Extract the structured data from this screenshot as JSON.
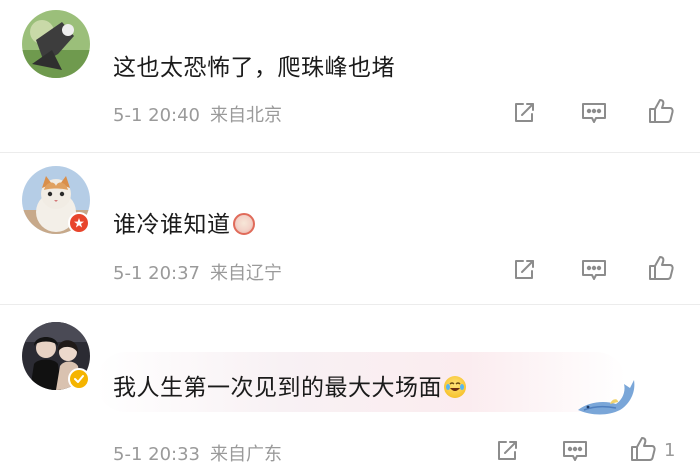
{
  "comments": [
    {
      "text": "这也太恐怖了，爬珠峰也堵",
      "time": "5-1 20:40",
      "location": "来自北京",
      "like_count": ""
    },
    {
      "text": "谁冷谁知道",
      "time": "5-1 20:37",
      "location": "来自辽宁",
      "like_count": "",
      "emoji": "laughing-crying-emoji"
    },
    {
      "text": "我人生第一次见到的最大大场面",
      "time": "5-1 20:33",
      "location": "来自广东",
      "like_count": "1",
      "emoji": "laughing-tears-emoji"
    }
  ],
  "icons": {
    "share": "share-icon",
    "reply": "comment-icon",
    "like": "thumbs-up-icon"
  },
  "colors": {
    "text": "#1b1b1b",
    "meta": "#9a9a9a",
    "icon": "#8c8c8c",
    "verified_red": "#e8452c",
    "verified_yellow": "#f5b400"
  }
}
